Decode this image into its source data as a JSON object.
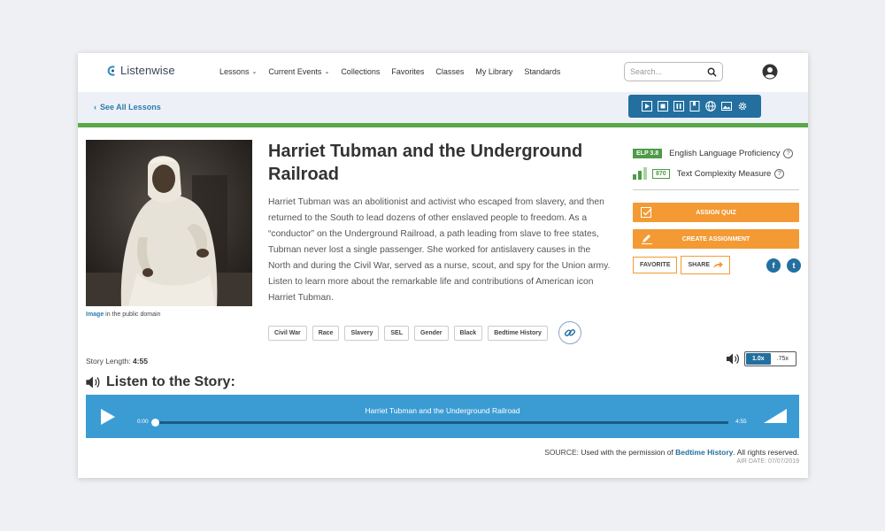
{
  "nav": {
    "logo": "Listenwise",
    "menu": [
      {
        "label": "Lessons",
        "dropdown": true
      },
      {
        "label": "Current Events",
        "dropdown": true
      },
      {
        "label": "Collections",
        "dropdown": false
      },
      {
        "label": "Favorites",
        "dropdown": false
      },
      {
        "label": "Classes",
        "dropdown": false
      },
      {
        "label": "My Library",
        "dropdown": false
      },
      {
        "label": "Standards",
        "dropdown": false
      }
    ],
    "search_placeholder": "Search...",
    "icons": [
      "search-icon",
      "user-avatar-icon"
    ]
  },
  "subbar": {
    "back_link": "See All Lessons",
    "toolbar_icons": [
      "play-icon",
      "stop-icon",
      "pause-icon",
      "bookmark-icon",
      "globe-icon",
      "picture-icon",
      "gear-icon"
    ]
  },
  "lesson": {
    "title": "Harriet Tubman and the Underground Railroad",
    "description": "Harriet Tubman was an abolitionist and activist who escaped from slavery, and then returned to the South to lead dozens of other enslaved people to freedom. As a “conductor” on the Underground Railroad, a path leading from slave to free states, Tubman never lost a single passenger. She worked for antislavery causes in the North and during the Civil War, served as a nurse, scout, and spy for the Union army. Listen to learn more about the remarkable life and contributions of American icon Harriet Tubman.",
    "image_credit_link": "Image",
    "image_credit_text": " in the public domain",
    "tags": [
      "Civil War",
      "Race",
      "Slavery",
      "SEL",
      "Gender",
      "Black",
      "Bedtime History"
    ]
  },
  "metrics": {
    "elp_badge": "ELP 3.8",
    "elp_label": "English Language Proficiency",
    "tcm_badge": "870",
    "tcm_label": "Text Complexity Measure",
    "help": "?"
  },
  "actions": {
    "assign_quiz": "ASSIGN QUIZ",
    "create_assignment": "CREATE ASSIGNMENT",
    "favorite": "FAVORITE",
    "share": "SHARE",
    "facebook": "f",
    "twitter": "t"
  },
  "story": {
    "length_label": "Story Length:",
    "length_value": "4:55",
    "speed_options": [
      "1.0x",
      ".75x"
    ],
    "speed_selected": "1.0x",
    "listen_heading": "Listen to the Story:"
  },
  "player": {
    "title": "Harriet Tubman and the Underground Railroad",
    "current_time": "0:00",
    "duration": "4:55",
    "progress": 0.0
  },
  "source": {
    "label": "SOURCE:",
    "text_before": "Used with the permission of",
    "link": "Bedtime History",
    "text_after": ". All rights reserved.",
    "air_date": "AIR DATE: 07/07/2019"
  },
  "colors": {
    "accent_blue": "#236fa0",
    "player_blue": "#3b9cd4",
    "green": "#5ba84a",
    "orange": "#f39a34"
  }
}
